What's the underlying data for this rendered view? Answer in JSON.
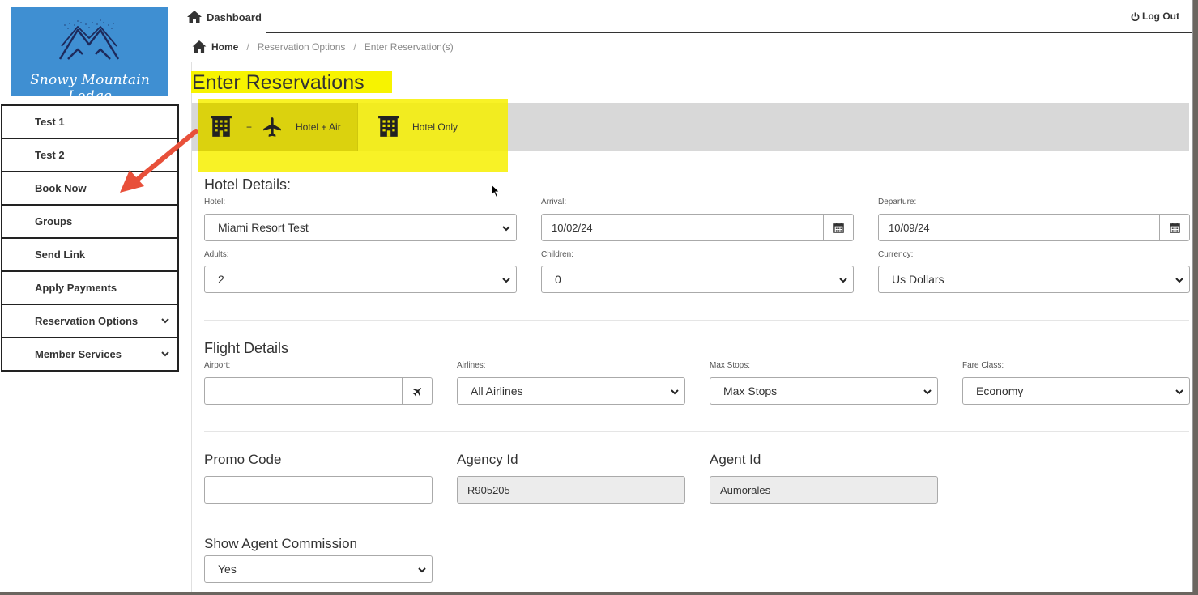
{
  "logo": {
    "text": "Snowy Mountain Lodge"
  },
  "sidebar": {
    "items": [
      {
        "label": "Test 1",
        "has_chevron": false
      },
      {
        "label": "Test 2",
        "has_chevron": false
      },
      {
        "label": "Book Now",
        "has_chevron": false
      },
      {
        "label": "Groups",
        "has_chevron": false
      },
      {
        "label": "Send Link",
        "has_chevron": false
      },
      {
        "label": "Apply Payments",
        "has_chevron": false
      },
      {
        "label": "Reservation Options",
        "has_chevron": true
      },
      {
        "label": "Member Services",
        "has_chevron": true
      }
    ]
  },
  "topbar": {
    "dashboard_label": "Dashboard",
    "logout_label": "Log Out"
  },
  "breadcrumb": {
    "home": "Home",
    "sep": "/",
    "level2": "Reservation Options",
    "level3": "Enter Reservation(s)"
  },
  "page": {
    "title": "Enter Reservations"
  },
  "type_selector": {
    "hotel_air_label": "Hotel + Air",
    "plus": "+",
    "hotel_only_label": "Hotel Only"
  },
  "hotel_details": {
    "title": "Hotel Details:",
    "hotel_label": "Hotel:",
    "hotel_value": "Miami Resort Test",
    "arrival_label": "Arrival:",
    "arrival_value": "10/02/24",
    "departure_label": "Departure:",
    "departure_value": "10/09/24",
    "adults_label": "Adults:",
    "adults_value": "2",
    "children_label": "Children:",
    "children_value": "0",
    "currency_label": "Currency:",
    "currency_value": "Us Dollars"
  },
  "flight_details": {
    "title": "Flight Details",
    "airport_label": "Airport:",
    "airport_value": "",
    "airlines_label": "Airlines:",
    "airlines_value": "All Airlines",
    "max_stops_label": "Max Stops:",
    "max_stops_value": "Max Stops",
    "fare_class_label": "Fare Class:",
    "fare_class_value": "Economy"
  },
  "agent": {
    "promo_label": "Promo Code",
    "promo_value": "",
    "agency_label": "Agency Id",
    "agency_value": "R905205",
    "agent_label": "Agent Id",
    "agent_value": "Aumorales",
    "commission_label": "Show Agent Commission",
    "commission_value": "Yes"
  },
  "colors": {
    "highlight": "#f7f300",
    "logo_bg": "#3f8fd2",
    "annotation_arrow": "#e8503a"
  }
}
